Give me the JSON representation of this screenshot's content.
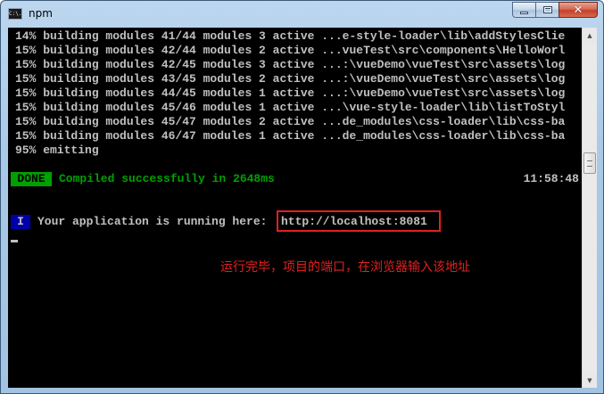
{
  "window": {
    "title": "npm",
    "app_icon_text": "C:\\."
  },
  "console": {
    "build_lines": [
      "14% building modules 41/44 modules 3 active ...e-style-loader\\lib\\addStylesClie",
      "15% building modules 42/44 modules 2 active ...vueTest\\src\\components\\HelloWorl",
      "15% building modules 42/45 modules 3 active ...:\\vueDemo\\vueTest\\src\\assets\\log",
      "15% building modules 43/45 modules 2 active ...:\\vueDemo\\vueTest\\src\\assets\\log",
      "15% building modules 44/45 modules 1 active ...:\\vueDemo\\vueTest\\src\\assets\\log",
      "15% building modules 45/46 modules 1 active ...\\vue-style-loader\\lib\\listToStyl",
      "15% building modules 45/47 modules 2 active ...de_modules\\css-loader\\lib\\css-ba",
      "15% building modules 46/47 modules 1 active ...de_modules\\css-loader\\lib\\css-ba",
      "95% emitting"
    ],
    "done_badge": "DONE",
    "compiled_message": "Compiled successfully in 2648ms",
    "time": "11:58:48",
    "info_badge": "I",
    "app_message": "Your application is running here:",
    "url": "http://localhost:8081",
    "annotation": "运行完毕，项目的端口，在浏览器输入该地址"
  },
  "colors": {
    "console_bg": "#000000",
    "console_text": "#c0c0c0",
    "done_green": "#00a000",
    "info_blue": "#0000a8",
    "annotation_red": "#e02020"
  },
  "icons": {
    "app": "console-icon",
    "minimize": "minimize-icon",
    "maximize": "maximize-icon",
    "close": "close-icon"
  }
}
